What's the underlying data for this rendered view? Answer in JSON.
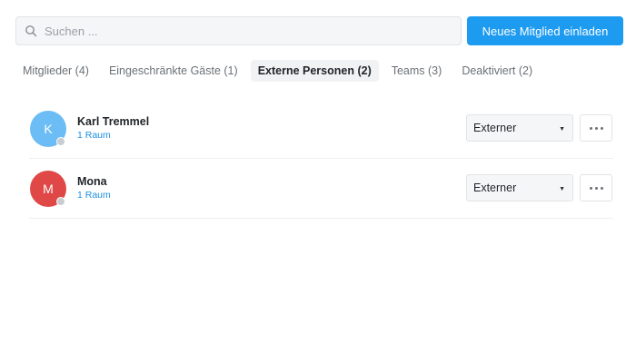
{
  "search": {
    "placeholder": "Suchen ...",
    "value": ""
  },
  "invite_button": {
    "label": "Neues Mitglied einladen",
    "color": "#1d9bf0"
  },
  "tabs": [
    {
      "label": "Mitglieder (4)",
      "active": false
    },
    {
      "label": "Eingeschränkte Gäste (1)",
      "active": false
    },
    {
      "label": "Externe Personen (2)",
      "active": true
    },
    {
      "label": "Teams (3)",
      "active": false
    },
    {
      "label": "Deaktiviert (2)",
      "active": false
    }
  ],
  "members": [
    {
      "initial": "K",
      "name": "Karl Tremmel",
      "rooms": "1 Raum",
      "role": "Externer",
      "avatar_color": "#6cbcf5"
    },
    {
      "initial": "M",
      "name": "Mona",
      "rooms": "1 Raum",
      "role": "Externer",
      "avatar_color": "#e04848"
    }
  ]
}
